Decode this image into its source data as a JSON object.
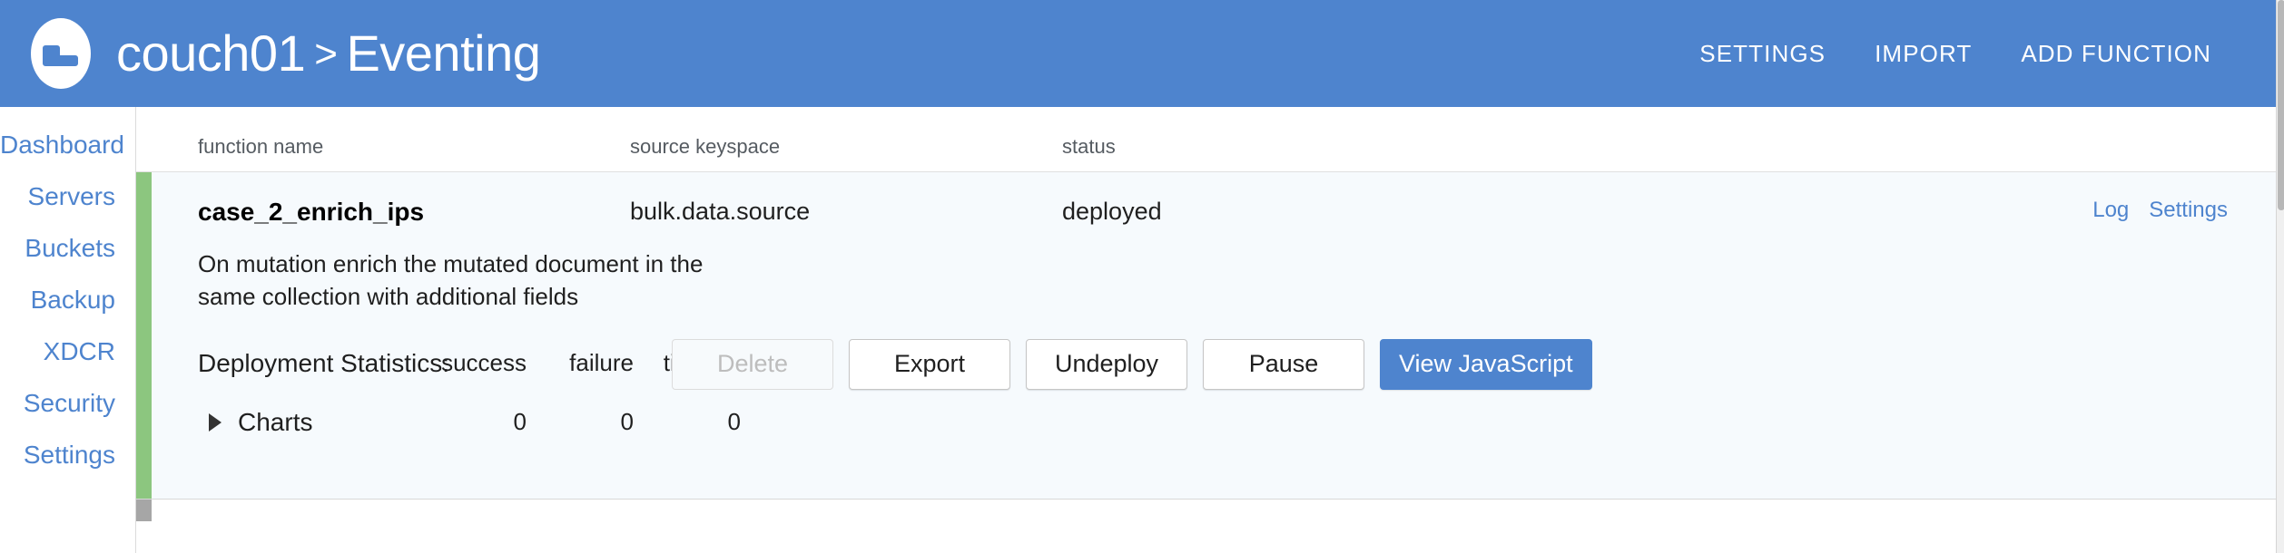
{
  "header": {
    "logo_icon": "couchbase-logo-icon",
    "cluster_name": "couch01",
    "separator": ">",
    "section": "Eventing",
    "actions": [
      {
        "label": "SETTINGS",
        "name": "settings"
      },
      {
        "label": "IMPORT",
        "name": "import"
      },
      {
        "label": "ADD FUNCTION",
        "name": "add-function"
      }
    ],
    "background_color": "#4e84ce"
  },
  "sidebar": {
    "items": [
      {
        "label": "Dashboard"
      },
      {
        "label": "Servers"
      },
      {
        "label": "Buckets"
      },
      {
        "label": "Backup"
      },
      {
        "label": "XDCR"
      },
      {
        "label": "Security"
      },
      {
        "label": "Settings"
      }
    ],
    "link_color": "#4e84ce"
  },
  "table": {
    "columns": {
      "function_name": "function name",
      "source_keyspace": "source keyspace",
      "status": "status"
    }
  },
  "function": {
    "name": "case_2_enrich_ips",
    "source_keyspace": "bulk.data.source",
    "status": "deployed",
    "status_accent_color": "#8cc67f",
    "row_links": [
      {
        "label": "Log",
        "name": "log"
      },
      {
        "label": "Settings",
        "name": "settings"
      }
    ],
    "description": "On mutation enrich the mutated document in the same collection with additional fields",
    "stats": {
      "title": "Deployment Statistics:",
      "labels": [
        "success",
        "failure",
        "timeout"
      ],
      "charts_label": "Charts",
      "charts_expanded": false,
      "values": [
        "0",
        "0",
        "0"
      ]
    },
    "buttons": [
      {
        "label": "Delete",
        "name": "delete",
        "state": "disabled",
        "style": "secondary"
      },
      {
        "label": "Export",
        "name": "export",
        "state": "enabled",
        "style": "secondary"
      },
      {
        "label": "Undeploy",
        "name": "undeploy",
        "state": "enabled",
        "style": "secondary"
      },
      {
        "label": "Pause",
        "name": "pause",
        "state": "enabled",
        "style": "secondary"
      },
      {
        "label": "View JavaScript",
        "name": "view-javascript",
        "state": "enabled",
        "style": "primary"
      }
    ]
  }
}
